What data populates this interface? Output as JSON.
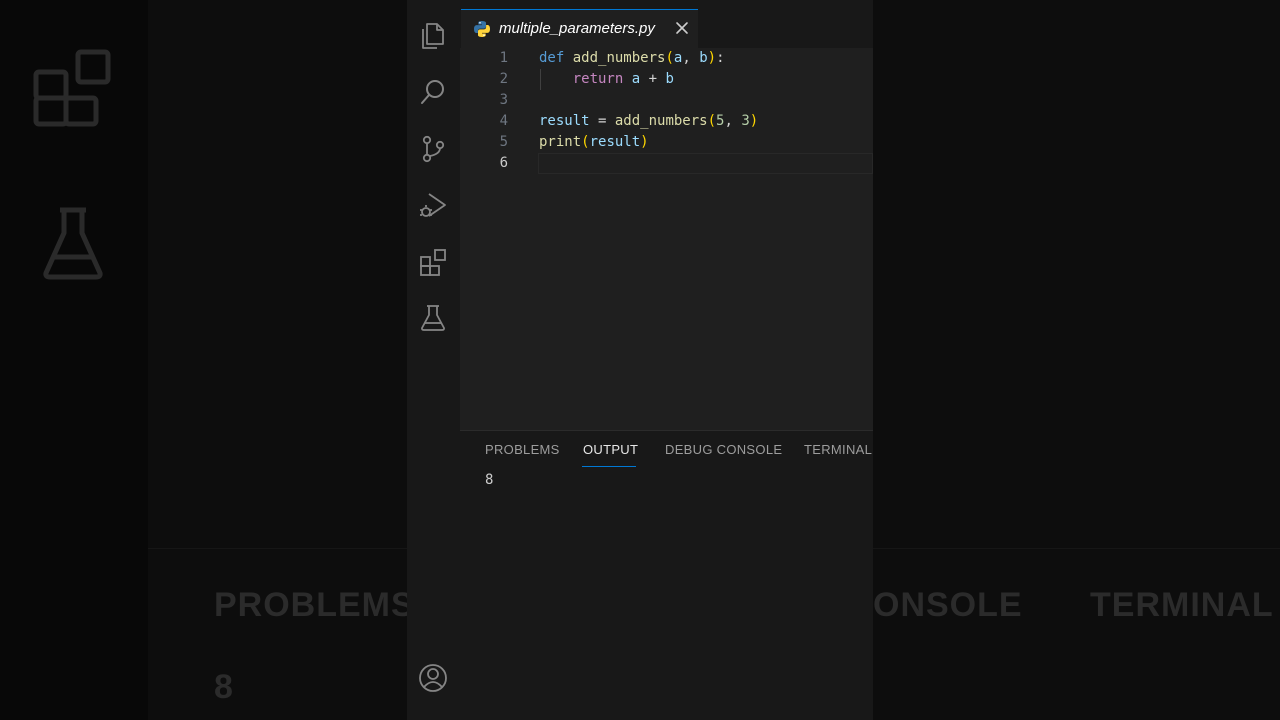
{
  "editor_tab": {
    "filename": "multiple_parameters.py",
    "language_icon": "python-icon",
    "close_icon": "close-icon"
  },
  "activity_bar": [
    {
      "name": "explorer",
      "icon": "files-icon"
    },
    {
      "name": "search",
      "icon": "search-icon"
    },
    {
      "name": "source-control",
      "icon": "source-control-icon"
    },
    {
      "name": "run-and-debug",
      "icon": "run-debug-icon"
    },
    {
      "name": "extensions",
      "icon": "extensions-icon"
    },
    {
      "name": "testing",
      "icon": "beaker-icon"
    },
    {
      "name": "accounts",
      "icon": "account-icon"
    }
  ],
  "code": {
    "line_numbers": [
      "1",
      "2",
      "3",
      "4",
      "5",
      "6"
    ],
    "l1": {
      "kw": "def",
      "sp": " ",
      "fn": "add_numbers",
      "po": "(",
      "a": "a",
      "comma": ", ",
      "b": "b",
      "pc": ")",
      "colon": ":"
    },
    "l2": {
      "indent": "    ",
      "kw": "return",
      "sp": " ",
      "a": "a",
      "op": " + ",
      "b": "b"
    },
    "l4": {
      "var": "result",
      "op": " = ",
      "fn": "add_numbers",
      "po": "(",
      "n1": "5",
      "comma": ", ",
      "n2": "3",
      "pc": ")"
    },
    "l5": {
      "fn": "print",
      "po": "(",
      "arg": "result",
      "pc": ")"
    }
  },
  "panel": {
    "tabs": [
      "PROBLEMS",
      "OUTPUT",
      "DEBUG CONSOLE",
      "TERMINAL"
    ],
    "active_tab": "OUTPUT",
    "output": "8"
  },
  "background_copy": {
    "problems": "PROBLEMS",
    "debug_console_fragment": "ONSOLE",
    "terminal": "TERMINAL",
    "output": "8"
  },
  "colors": {
    "accent": "#0078d4",
    "editor_bg": "#1f1f1f",
    "sidebar_bg": "#181818",
    "python_blue": "#3572A5",
    "python_yellow": "#FFD43B"
  }
}
